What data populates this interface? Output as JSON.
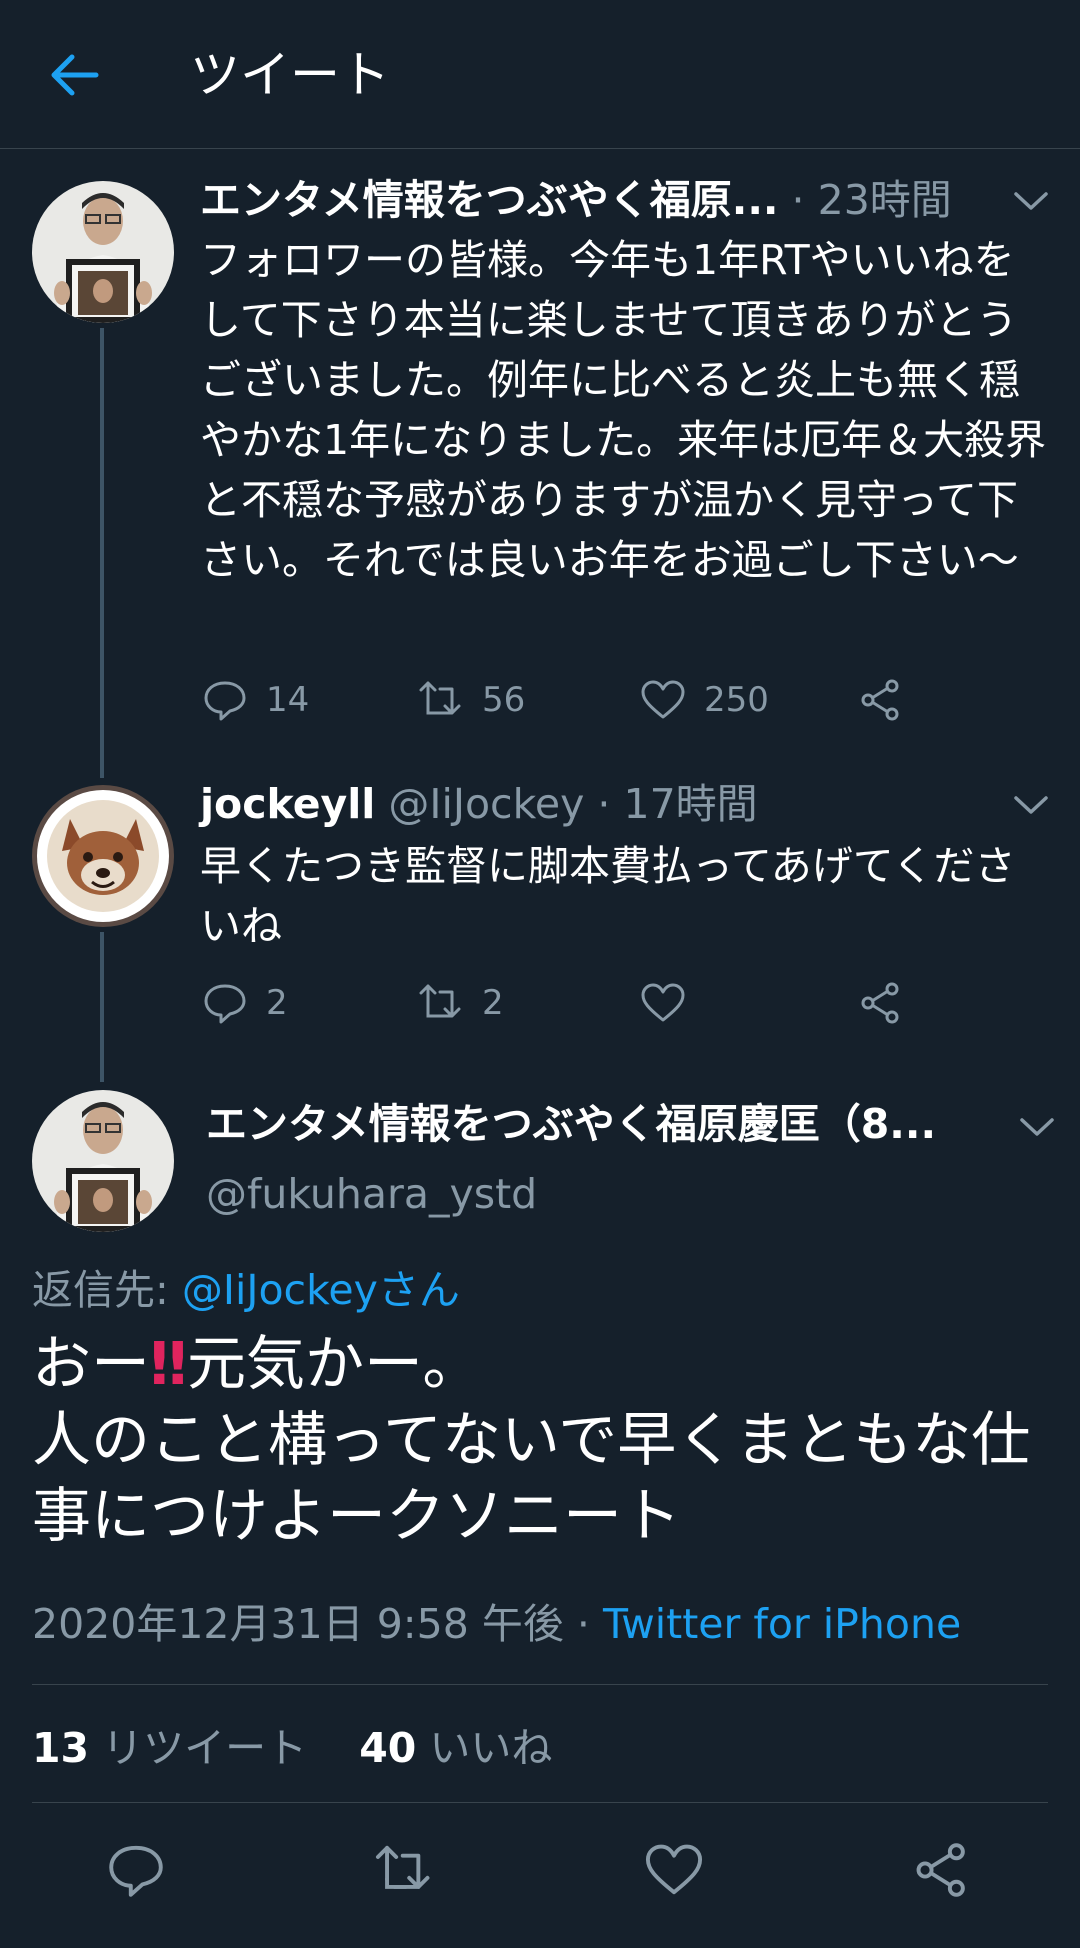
{
  "header": {
    "title": "ツイート",
    "back_icon": "arrow-left-icon",
    "accent": "#1da1f2"
  },
  "thread": [
    {
      "name": "エンタメ情報をつぶやく福原...",
      "time": "· 23時間",
      "text": "フォロワーの皆様。今年も1年RTやいいねをして下さり本当に楽しませて頂きありがとうございました。例年に比べると炎上も無く穏やかな1年になりました。来年は厄年＆大殺界と不穏な予感がありますが温かく見守って下さい。それでは良いお年をお過ごし下さい〜",
      "counts": {
        "replies": "14",
        "retweets": "56",
        "likes": "250"
      }
    },
    {
      "name": "jockeyll",
      "handle": "@IiJockey",
      "time": "· 17時間",
      "text": "早くたつき監督に脚本費払ってあげてくださいね",
      "counts": {
        "replies": "2",
        "retweets": "2"
      }
    }
  ],
  "main": {
    "name": "エンタメ情報をつぶやく福原慶匡（8...",
    "handle": "@fukuhara_ystd",
    "reply_label": "返信先:",
    "reply_to": "@IiJockeyさん",
    "text_line1_a": "おー",
    "text_emoji": "‼",
    "text_line1_b": "元気かー。",
    "text_line2": "人のこと構ってないで早くまともな仕事につけよークソニート",
    "timestamp": "2020年12月31日 9:58 午後 ·",
    "source": "Twitter for iPhone",
    "retweet_count": "13",
    "retweet_label": "リツイート",
    "like_count": "40",
    "like_label": "いいね"
  }
}
